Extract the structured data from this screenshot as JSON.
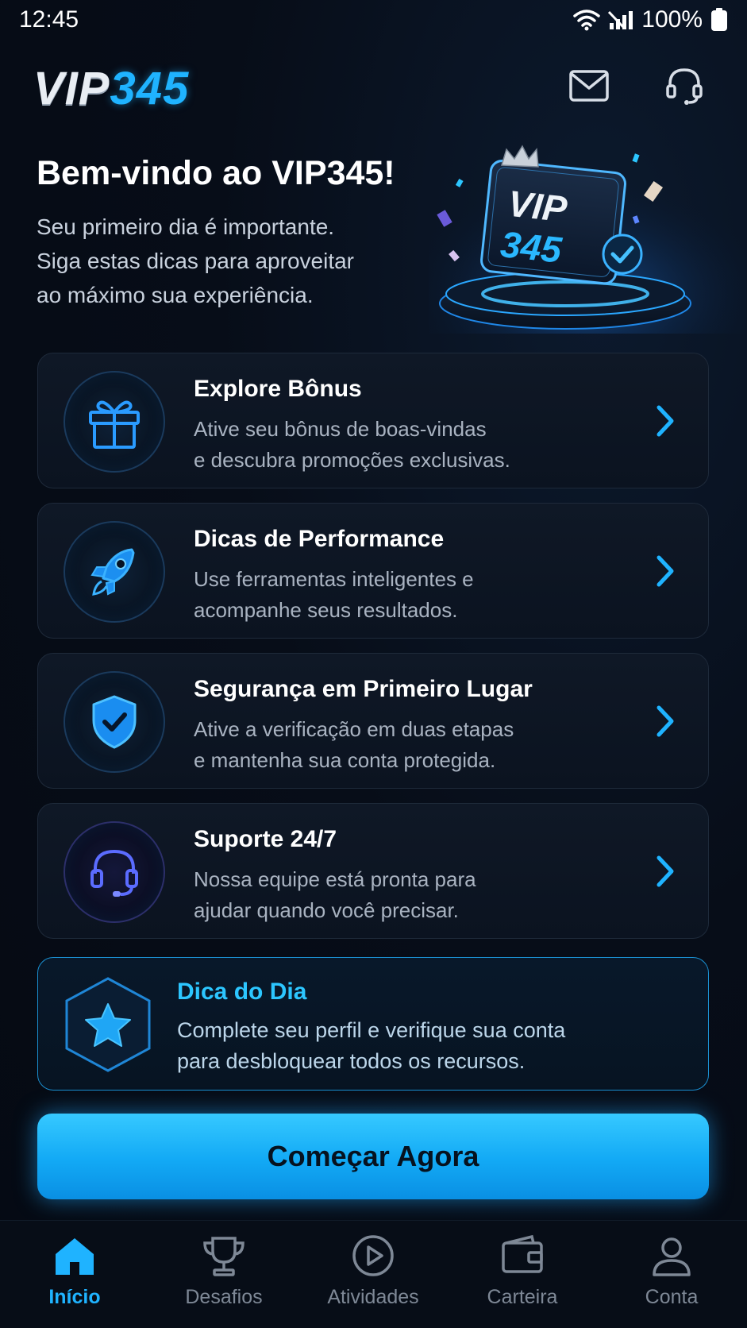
{
  "status_bar": {
    "time": "12:45",
    "battery": "100%"
  },
  "header": {
    "logo_main": "VIP",
    "logo_accent": "345",
    "mail_icon": "mail-icon",
    "support_icon": "headset-icon"
  },
  "hero": {
    "title": "Bem-vindo ao VIP345!",
    "subtitle_lines": [
      "Seu primeiro dia é importante.",
      "Siga estas dicas para aproveitar",
      "ao máximo sua experiência."
    ],
    "art_text_top": "VIP",
    "art_text_bottom": "345"
  },
  "cards": [
    {
      "title": "Explore Bônus",
      "desc_lines": [
        "Ative seu bônus de boas-vindas",
        "e descubra promoções exclusivas."
      ],
      "icon": "gift-icon"
    },
    {
      "title": "Dicas de Performance",
      "desc_lines": [
        "Use ferramentas inteligentes e",
        "acompanhe seus resultados."
      ],
      "icon": "rocket-icon"
    },
    {
      "title": "Segurança em Primeiro Lugar",
      "desc_lines": [
        "Ative a verificação em duas etapas",
        "e mantenha sua conta protegida."
      ],
      "icon": "shield-check-icon"
    },
    {
      "title": "Suporte 24/7",
      "desc_lines": [
        "Nossa equipe está pronta para",
        "ajudar quando você precisar."
      ],
      "icon": "headset-icon"
    }
  ],
  "tip": {
    "title": "Dica do Dia",
    "desc_lines": [
      "Complete seu perfil e verifique sua conta",
      "para desbloquear todos os recursos."
    ],
    "icon": "star-icon"
  },
  "cta": {
    "label": "Começar Agora"
  },
  "bottom_nav": [
    {
      "label": "Início",
      "icon": "home-icon",
      "active": true
    },
    {
      "label": "Desafios",
      "icon": "trophy-icon",
      "active": false
    },
    {
      "label": "Atividades",
      "icon": "play-icon",
      "active": false
    },
    {
      "label": "Carteira",
      "icon": "wallet-icon",
      "active": false
    },
    {
      "label": "Conta",
      "icon": "user-icon",
      "active": false
    }
  ],
  "colors": {
    "accent": "#1fb3ff",
    "background": "#060c16",
    "card_bg": "#0f1826",
    "muted_text": "#a9b3c1"
  }
}
